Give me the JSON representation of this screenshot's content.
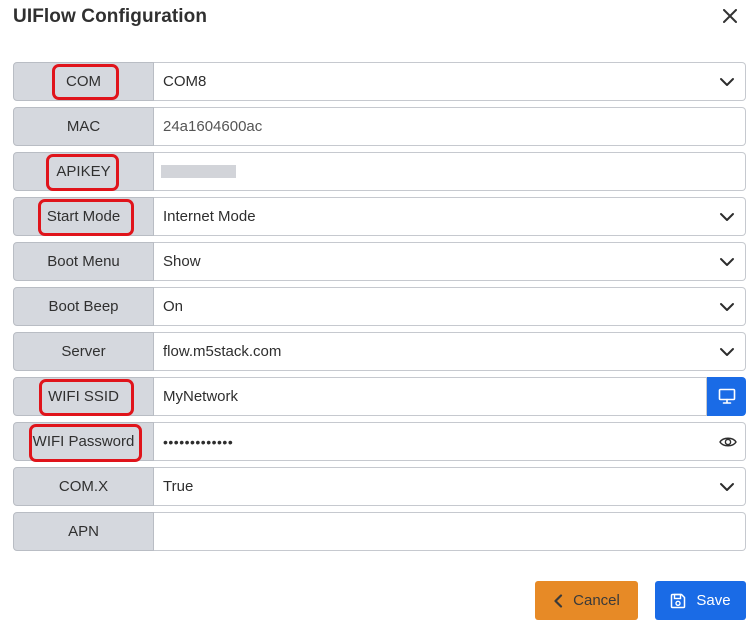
{
  "dialog": {
    "title": "UIFlow Configuration",
    "close_icon": "close-icon"
  },
  "fields": {
    "com": {
      "label": "COM",
      "value": "COM8",
      "highlighted": true,
      "type": "select"
    },
    "mac": {
      "label": "MAC",
      "value": "24a1604600ac",
      "highlighted": false,
      "type": "readonly"
    },
    "apikey": {
      "label": "APIKEY",
      "value": "",
      "highlighted": true,
      "type": "masked"
    },
    "start_mode": {
      "label": "Start Mode",
      "value": "Internet Mode",
      "highlighted": true,
      "type": "select"
    },
    "boot_menu": {
      "label": "Boot Menu",
      "value": "Show",
      "highlighted": false,
      "type": "select"
    },
    "boot_beep": {
      "label": "Boot Beep",
      "value": "On",
      "highlighted": false,
      "type": "select"
    },
    "server": {
      "label": "Server",
      "value": "flow.m5stack.com",
      "highlighted": false,
      "type": "select"
    },
    "wifi_ssid": {
      "label": "WIFI SSID",
      "value": "MyNetwork",
      "highlighted": true,
      "type": "input-with-button",
      "button_icon": "monitor-icon"
    },
    "wifi_password": {
      "label": "WIFI Password",
      "value": "•••••••••••••",
      "highlighted": true,
      "type": "password",
      "toggle_icon": "eye-icon"
    },
    "comx": {
      "label": "COM.X",
      "value": "True",
      "highlighted": false,
      "type": "select"
    },
    "apn": {
      "label": "APN",
      "value": "",
      "highlighted": false,
      "type": "input"
    }
  },
  "footer": {
    "cancel_label": "Cancel",
    "cancel_icon": "chevron-left-icon",
    "save_label": "Save",
    "save_icon": "save-icon"
  },
  "colors": {
    "highlight": "#e0141b",
    "primary": "#1a6be6",
    "cancel": "#e78a26",
    "label_bg": "#d5d8de"
  }
}
